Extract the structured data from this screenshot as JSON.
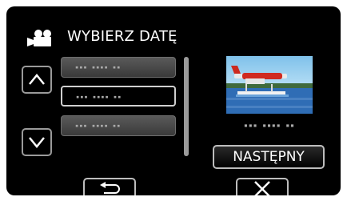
{
  "header": {
    "icon": "movie-camera-icon",
    "title": "WYBIERZ DATĘ"
  },
  "list": {
    "items": [
      {
        "label": "▪▪▪ ▪▪▪▪ ▪▪",
        "selected": false
      },
      {
        "label": "▪▪▪ ▪▪▪▪ ▪▪",
        "selected": true
      },
      {
        "label": "▪▪▪ ▪▪▪▪ ▪▪",
        "selected": false
      }
    ],
    "up_icon": "chevron-up-icon",
    "down_icon": "chevron-down-icon"
  },
  "preview": {
    "date_label": "▪▪▪ ▪▪▪▪ ▪▪"
  },
  "actions": {
    "next_label": "NASTĘPNY",
    "back_icon": "return-arrow-icon",
    "close_icon": "close-icon"
  }
}
